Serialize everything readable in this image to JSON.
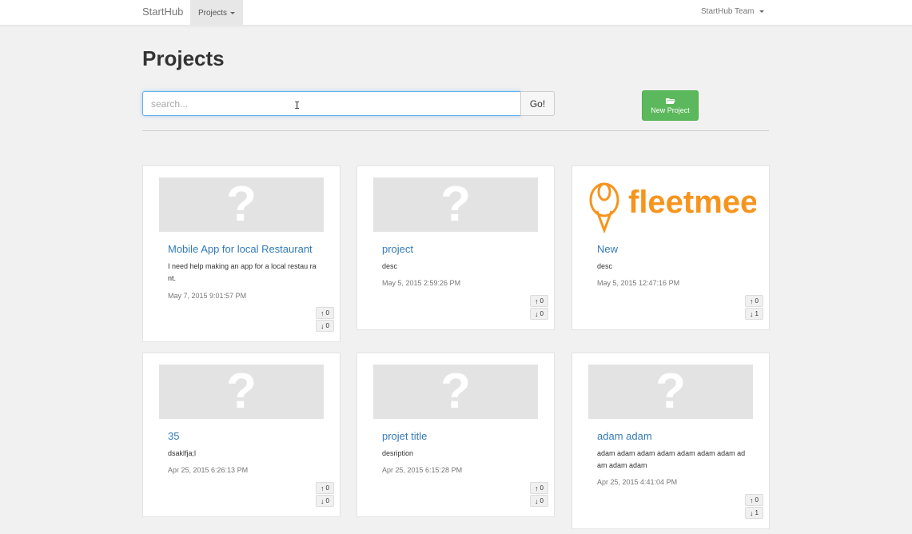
{
  "navbar": {
    "brand": "StartHub",
    "projects_label": "Projects",
    "team_label": "StartHub Team"
  },
  "page": {
    "title": "Projects"
  },
  "search": {
    "placeholder": "search...",
    "go_label": "Go!"
  },
  "new_project": {
    "label": "New Project",
    "icon": "folder-open-icon"
  },
  "projects": [
    {
      "title": "Mobile App for local Restaurant",
      "description": "I need help making an app for a local restau rant.",
      "date": "May 7, 2015 9:01:57 PM",
      "upvotes": "0",
      "downvotes": "0",
      "image": "placeholder"
    },
    {
      "title": "project",
      "description": "desc",
      "date": "May 5, 2015 2:59:26 PM",
      "upvotes": "0",
      "downvotes": "0",
      "image": "placeholder"
    },
    {
      "title": "New",
      "description": "desc",
      "date": "May 5, 2015 12:47:16 PM",
      "upvotes": "0",
      "downvotes": "1",
      "image": "fleetmeet-logo",
      "logo_text": "fleetmeet",
      "logo_color": "#f7941d"
    },
    {
      "title": "35",
      "description": "dsaklfja;l",
      "date": "Apr 25, 2015 6:26:13 PM",
      "upvotes": "0",
      "downvotes": "0",
      "image": "placeholder"
    },
    {
      "title": "projet title",
      "description": "desription",
      "date": "Apr 25, 2015 6:15:28 PM",
      "upvotes": "0",
      "downvotes": "0",
      "image": "placeholder"
    },
    {
      "title": "adam adam",
      "description": "adam adam adam adam adam adam adam adam adam adam",
      "date": "Apr 25, 2015 4:41:04 PM",
      "upvotes": "0",
      "downvotes": "1",
      "image": "placeholder"
    }
  ],
  "colors": {
    "link": "#337ab7",
    "success": "#5cb85c",
    "focus": "#66afe9"
  }
}
